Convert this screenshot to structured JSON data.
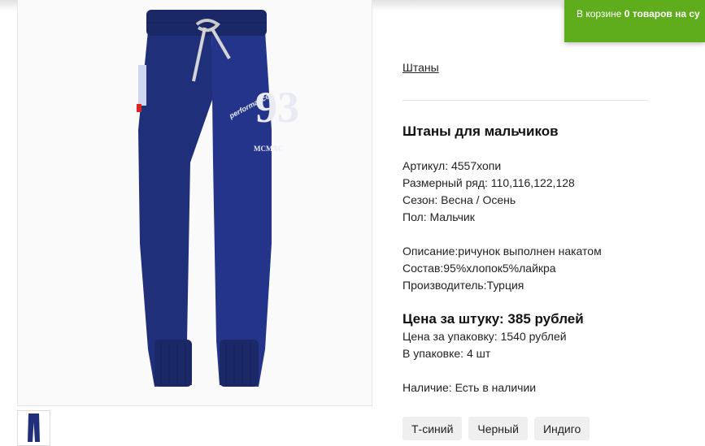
{
  "cart": {
    "prefix": "В корзине",
    "count": "0 товаров на су"
  },
  "breadcrumb": "Штаны",
  "product": {
    "title": "Штаны для мальчиков",
    "article": "Артикул: 4557хопи",
    "sizes": "Размерный ряд: 110,116,122,128",
    "season": "Сезон: Весна / Осень",
    "gender": "Пол: Мальчик",
    "description": "Описание:ричунок выполнен накатом",
    "composition": "Состав:95%хлопок5%лайкра",
    "manufacturer": "Производитель:Турция",
    "price_unit": "Цена за штуку: 385 рублей",
    "price_pack": "Цена за упаковку: 1540 рублей",
    "pack_qty": "В упаковке: 4 шт",
    "availability": "Наличие: Есть в наличии"
  },
  "image_print": {
    "word": "performance",
    "number": "93",
    "roman": "MCMXC"
  },
  "variants": [
    "Т-синий",
    "Черный",
    "Индиго"
  ],
  "colors": {
    "pants": "#1f2f7a",
    "cart_bg": "#5fac1d",
    "variant_bg": "#efefef"
  }
}
